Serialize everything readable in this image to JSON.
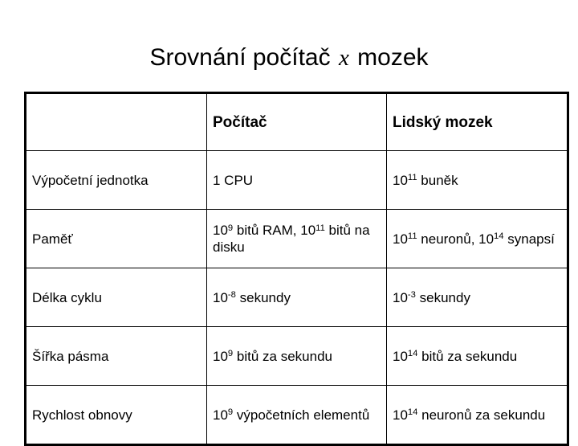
{
  "slide": {
    "title_prefix": "Srovnání počítač",
    "title_variable": "x",
    "title_suffix": "mozek"
  },
  "table": {
    "headers": {
      "label": "",
      "computer": "Počítač",
      "brain": "Lidský mozek"
    },
    "rows": [
      {
        "label": "Výpočetní jednotka",
        "computer_html": "1 CPU",
        "brain_html": "10<sup>11</sup> buněk",
        "computer_text": "1 CPU",
        "brain_text": "10^11 buněk"
      },
      {
        "label": "Paměť",
        "computer_html": "10<sup>9</sup> bitů RAM, 10<sup>11</sup> bitů na disku",
        "brain_html": "10<sup>11</sup> neuronů, 10<sup>14</sup> synapsí",
        "computer_text": "10^9 bitů RAM, 10^11 bitů na disku",
        "brain_text": "10^11 neuronů, 10^14 synapsí"
      },
      {
        "label": "Délka cyklu",
        "computer_html": "10<sup>-8</sup> sekundy",
        "brain_html": "10<sup>-3</sup> sekundy",
        "computer_text": "10^-8 sekundy",
        "brain_text": "10^-3 sekundy"
      },
      {
        "label": "Šířka pásma",
        "computer_html": "10<sup>9</sup> bitů za sekundu",
        "brain_html": "10<sup>14</sup> bitů za sekundu",
        "computer_text": "10^9 bitů za sekundu",
        "brain_text": "10^14 bitů za sekundu"
      },
      {
        "label": "Rychlost obnovy",
        "computer_html": "10<sup>9</sup> výpočetních elementů",
        "brain_html": "10<sup>14</sup> neuronů za sekundu",
        "computer_text": "10^9 výpočetních elementů",
        "brain_text": "10^14 neuronů za sekundu"
      }
    ]
  },
  "colors": {
    "background": "#ffffff",
    "text": "#000000",
    "border": "#000000"
  }
}
